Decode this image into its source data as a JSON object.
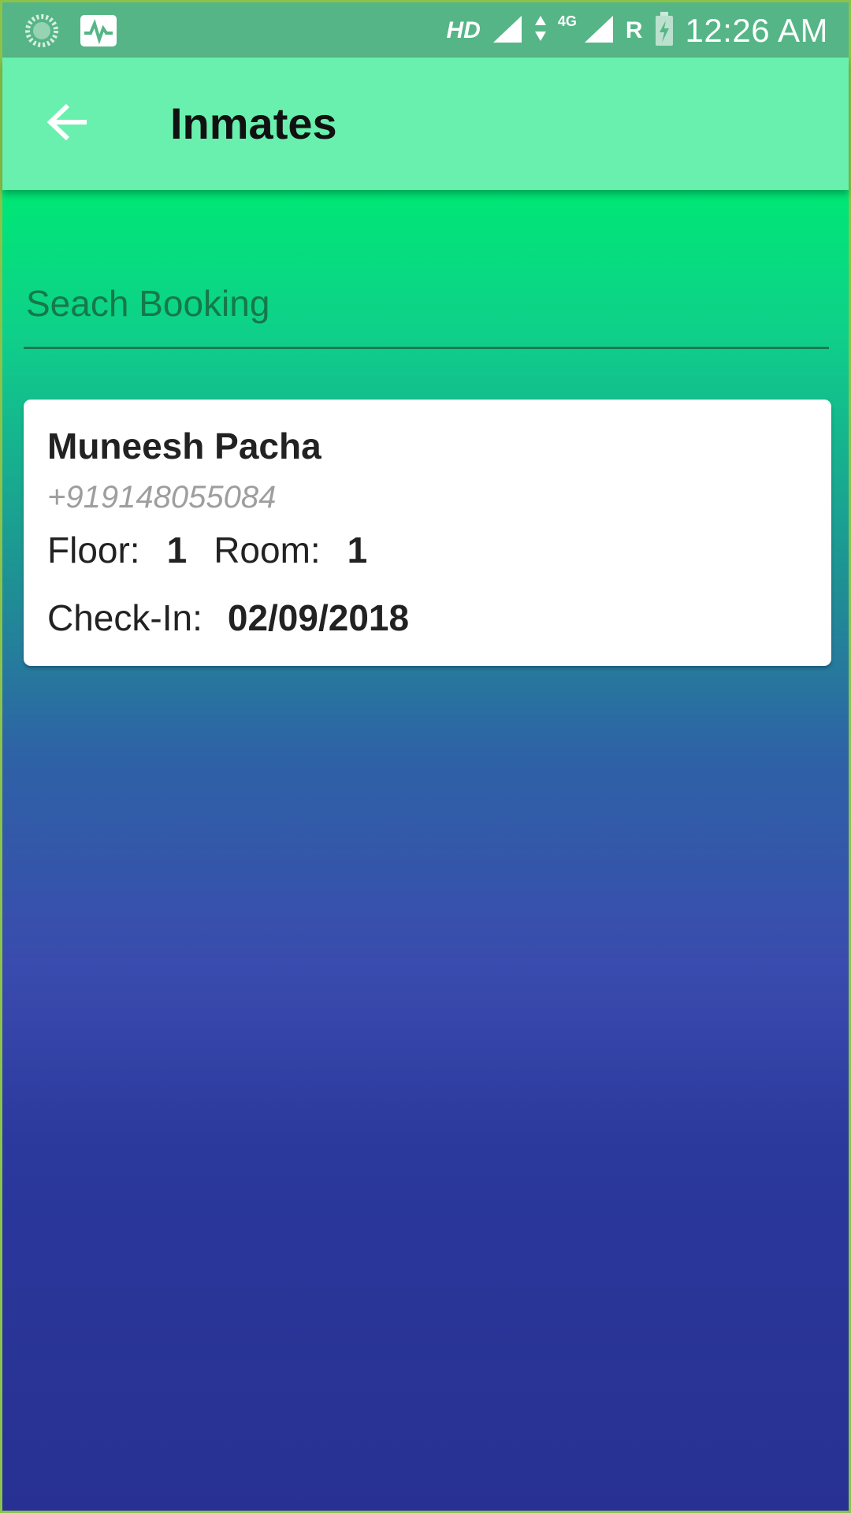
{
  "status_bar": {
    "network_label": "HD",
    "network_type": "4G",
    "roaming": "R",
    "time": "12:26 AM"
  },
  "app_bar": {
    "title": "Inmates"
  },
  "search": {
    "placeholder": "Seach Booking"
  },
  "inmates": [
    {
      "name": "Muneesh Pacha",
      "phone": "+919148055084",
      "floor_label": "Floor:",
      "floor": "1",
      "room_label": "Room:",
      "room": "1",
      "checkin_label": "Check-In:",
      "checkin": "02/09/2018"
    }
  ],
  "colors": {
    "status_bar": "#55b586",
    "app_bar": "#69f0ae",
    "accent_green": "#00e676",
    "gradient_blue": "#283193"
  }
}
